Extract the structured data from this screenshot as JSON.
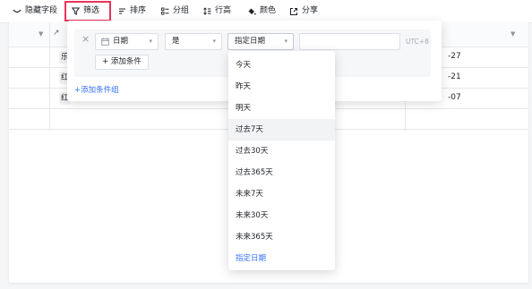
{
  "toolbar": {
    "items": [
      {
        "label": "隐藏字段",
        "icon": "eye-hidden-icon"
      },
      {
        "label": "筛选",
        "icon": "filter-icon"
      },
      {
        "label": "排序",
        "icon": "sort-icon"
      },
      {
        "label": "分组",
        "icon": "group-icon"
      },
      {
        "label": "行高",
        "icon": "row-height-icon"
      },
      {
        "label": "颜色",
        "icon": "paint-bucket-icon"
      },
      {
        "label": "分享",
        "icon": "share-icon"
      }
    ],
    "highlight_color": "#e8345a"
  },
  "grid": {
    "header_partial": "↗",
    "rows": [
      {
        "tag": "乐",
        "date": "-27"
      },
      {
        "tag": "红",
        "date": "-21"
      },
      {
        "tag": "红",
        "date": "-07"
      }
    ]
  },
  "filter": {
    "close": "×",
    "field": "日期",
    "operator": "是",
    "value_mode": "指定日期",
    "timezone": "UTC+8",
    "add_condition": "+ 添加条件",
    "add_group": "+添加条件组"
  },
  "menu": {
    "items": [
      "今天",
      "昨天",
      "明天",
      "过去7天",
      "过去30天",
      "过去365天",
      "未来7天",
      "未来30天",
      "未来365天",
      "指定日期"
    ],
    "hover_index": 3,
    "selected_index": 9,
    "accent": "#3370ff"
  }
}
